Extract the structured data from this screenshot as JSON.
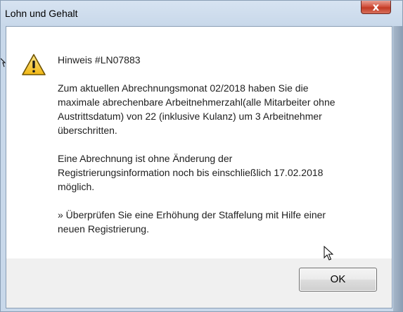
{
  "window": {
    "title": "Lohn und Gehalt",
    "close_symbol": "x"
  },
  "dialog": {
    "icon": "warning-icon",
    "heading": "Hinweis #LN07883",
    "paragraph1": "Zum aktuellen Abrechnungsmonat 02/2018 haben Sie die\nmaximale abrechenbare Arbeitnehmerzahl(alle Mitarbeiter ohne\nAustrittsdatum) von 22 (inklusive Kulanz) um 3 Arbeitnehmer\nüberschritten.",
    "paragraph2": "Eine Abrechnung ist ohne Änderung der\nRegistrierungsinformation noch bis einschließlich 17.02.2018\nmöglich.",
    "paragraph3": "» Überprüfen Sie eine Erhöhung der Staffelung mit Hilfe einer\nneuen Registrierung."
  },
  "buttons": {
    "ok_label": "OK"
  },
  "colors": {
    "warning_fill": "#f7c531",
    "warning_border": "#6e5200",
    "close_button": "#c9412b"
  }
}
